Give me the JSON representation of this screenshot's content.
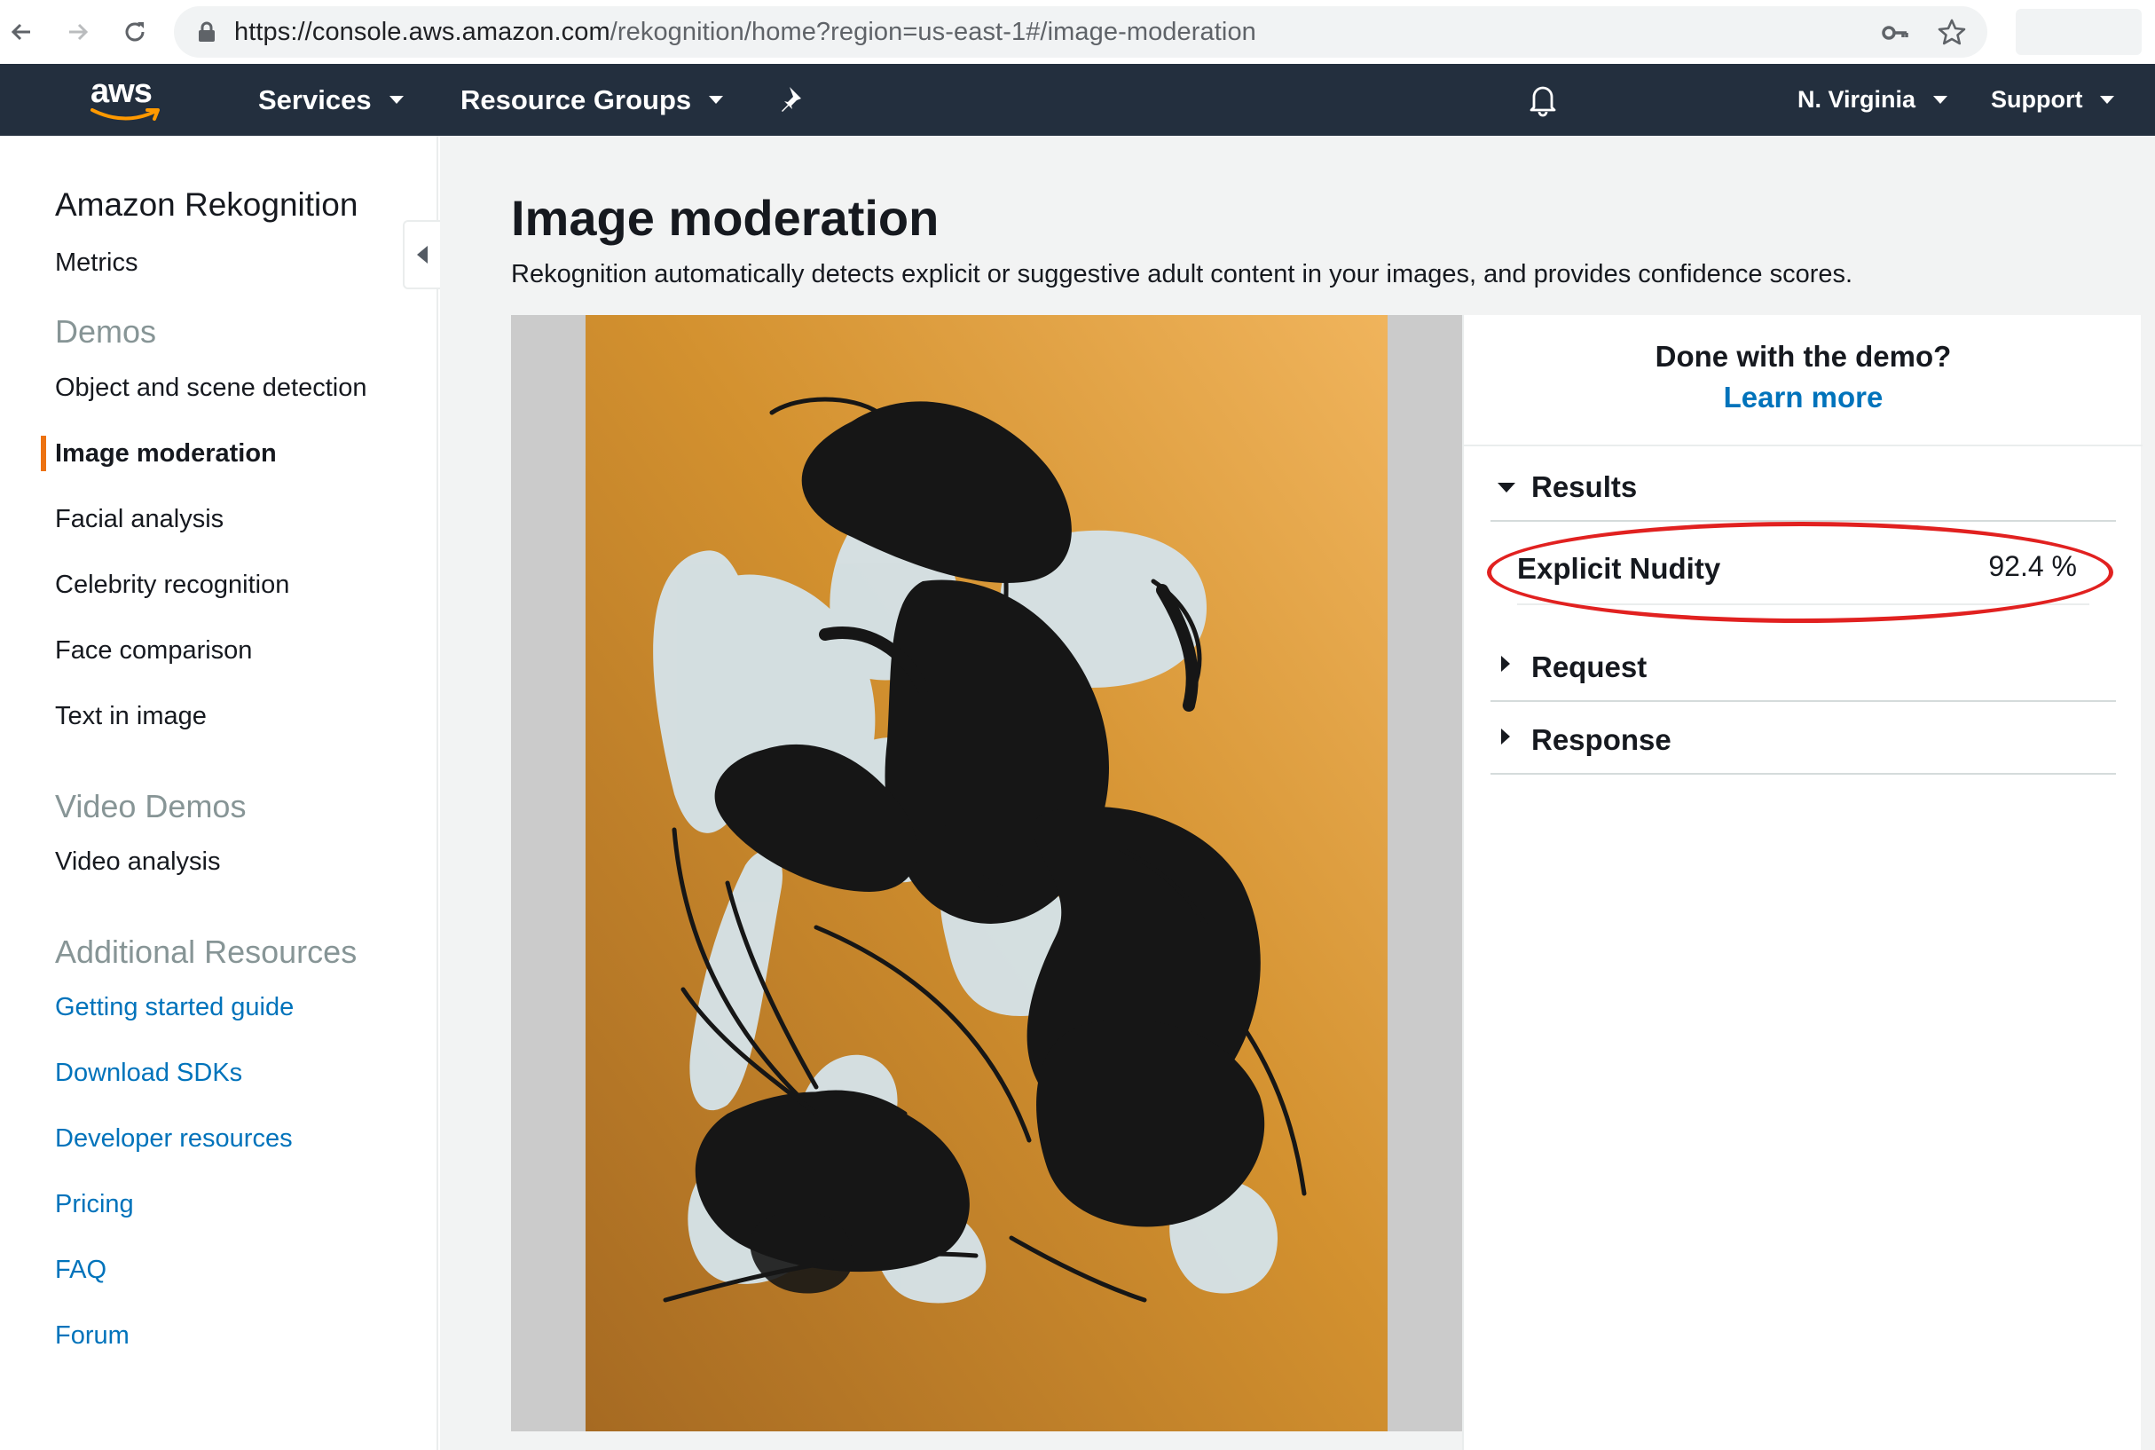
{
  "browser": {
    "url_host": "https://console.aws.amazon.com",
    "url_path": "/rekognition/home?region=us-east-1#/image-moderation"
  },
  "topnav": {
    "logo_text": "aws",
    "services_label": "Services",
    "resource_groups_label": "Resource Groups",
    "region_label": "N. Virginia",
    "support_label": "Support"
  },
  "sidebar": {
    "title": "Amazon Rekognition",
    "metrics": "Metrics",
    "demos_heading": "Demos",
    "demos": [
      {
        "label": "Object and scene detection",
        "active": false
      },
      {
        "label": "Image moderation",
        "active": true
      },
      {
        "label": "Facial analysis",
        "active": false
      },
      {
        "label": "Celebrity recognition",
        "active": false
      },
      {
        "label": "Face comparison",
        "active": false
      },
      {
        "label": "Text in image",
        "active": false
      }
    ],
    "video_heading": "Video Demos",
    "video_items": [
      {
        "label": "Video analysis"
      }
    ],
    "resources_heading": "Additional Resources",
    "resources": [
      {
        "label": "Getting started guide"
      },
      {
        "label": "Download SDKs"
      },
      {
        "label": "Developer resources"
      },
      {
        "label": "Pricing"
      },
      {
        "label": "FAQ"
      },
      {
        "label": "Forum"
      }
    ]
  },
  "main": {
    "title": "Image moderation",
    "description": "Rekognition automatically detects explicit or suggestive adult content in your images, and provides confidence scores."
  },
  "results_panel": {
    "done_title": "Done with the demo?",
    "learn_more": "Learn more",
    "results_label": "Results",
    "result_items": [
      {
        "name": "Explicit Nudity",
        "value": "92.4 %"
      }
    ],
    "request_label": "Request",
    "response_label": "Response"
  },
  "colors": {
    "aws_nav_bg": "#232f3e",
    "accent_orange": "#ec7211",
    "link_blue": "#0073bb",
    "annotation_red": "#e12120"
  }
}
